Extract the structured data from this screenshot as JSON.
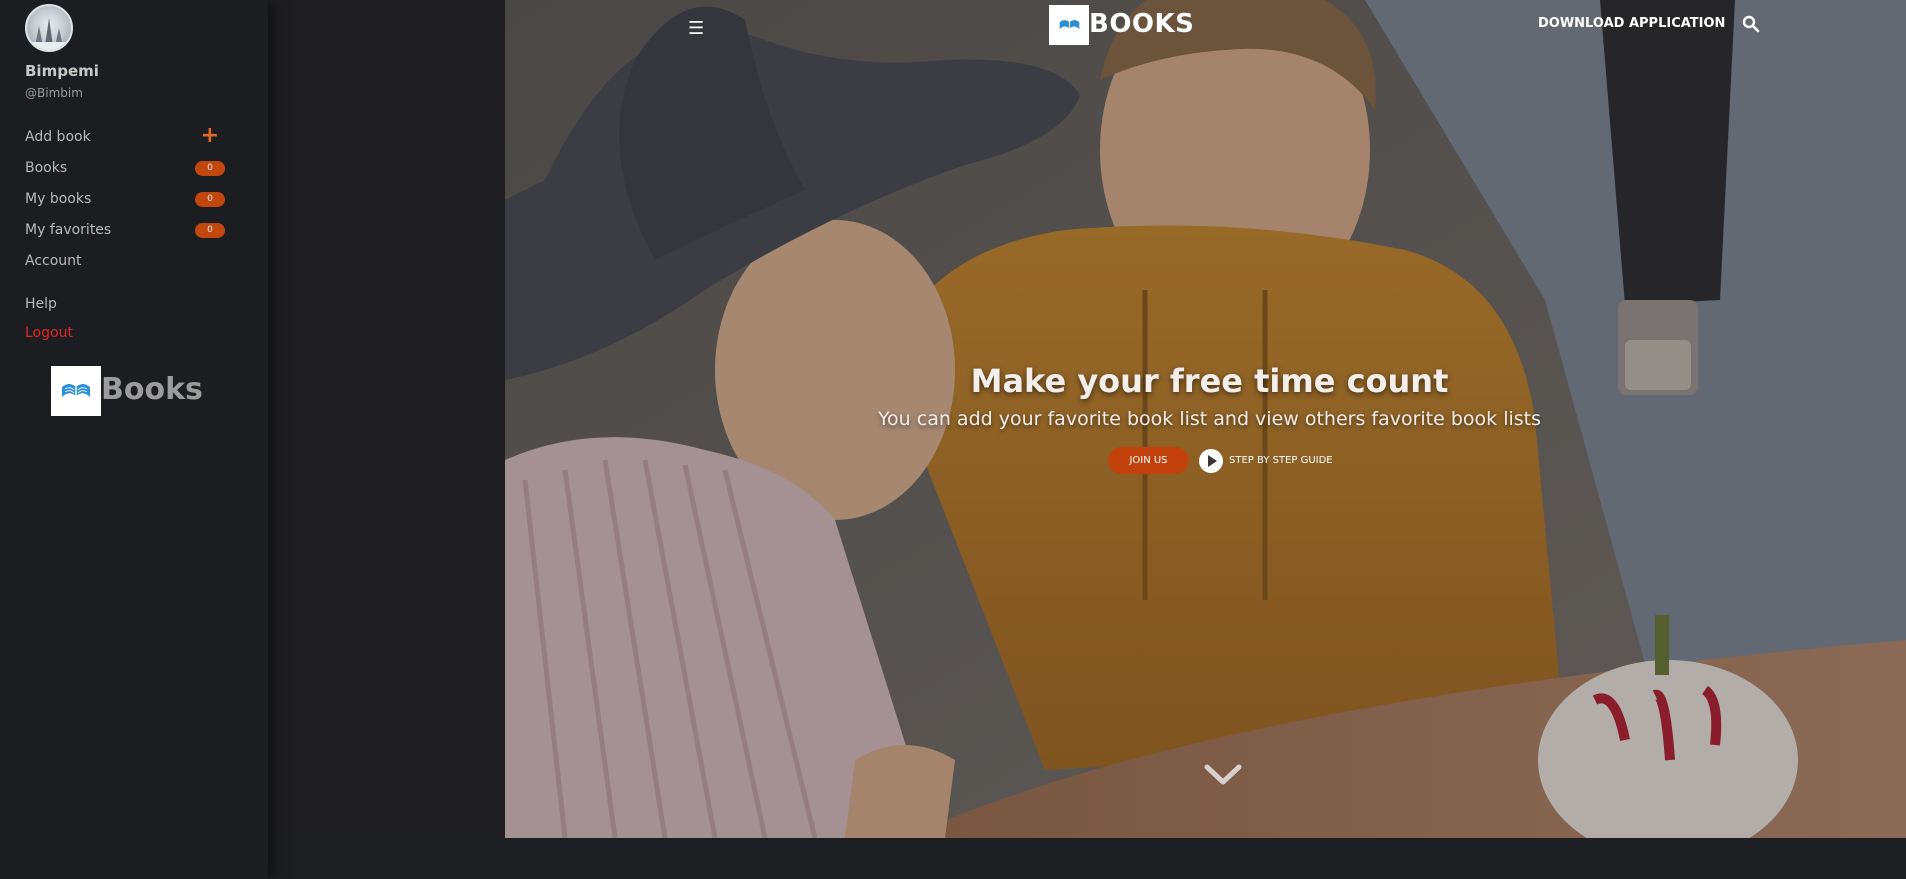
{
  "user": {
    "name": "Bimpemi",
    "handle": "@Bimbim"
  },
  "sidebar": {
    "items": [
      {
        "label": "Add book",
        "icon": "plus-icon"
      },
      {
        "label": "Books",
        "count": "0"
      },
      {
        "label": "My books",
        "count": "0"
      },
      {
        "label": "My favorites",
        "count": "0"
      },
      {
        "label": "Account"
      },
      {
        "label": "Help"
      },
      {
        "label": "Logout"
      }
    ],
    "logo_text": "Books"
  },
  "nav": {
    "brand": "BOOKS",
    "download_label": "DOWNLOAD APPLICATION",
    "menu_icon": "hamburger-icon",
    "search_icon": "search-icon"
  },
  "hero": {
    "title": "Make your free time count",
    "subtitle": "You can add your favorite book list and view others favorite book lists",
    "join_label": "JOIN US",
    "guide_label": "STEP BY STEP GUIDE"
  },
  "colors": {
    "accent": "#c2410d",
    "logout": "#e3262a",
    "sidebar_bg": "#1c1d20"
  }
}
